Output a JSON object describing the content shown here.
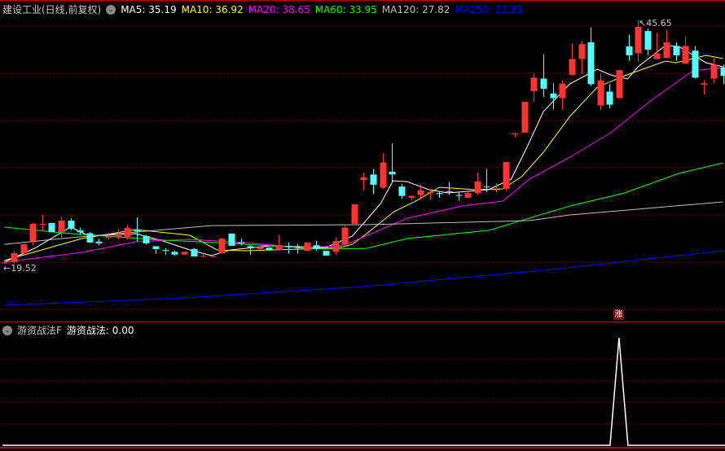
{
  "header": {
    "title": "建设工业(日线,前复权)",
    "ma_labels": [
      {
        "text": "MA5: 35.19",
        "color": "#ffffff"
      },
      {
        "text": "MA10: 36.92",
        "color": "#ffff00"
      },
      {
        "text": "MA20: 38.65",
        "color": "#ff00ff"
      },
      {
        "text": "MA60: 33.95",
        "color": "#00ff00"
      },
      {
        "text": "MA120: 27.82",
        "color": "#c0c0c0"
      },
      {
        "text": "MA250: 22.81",
        "color": "#0000ff"
      }
    ]
  },
  "indicator": {
    "name": "游资战法F",
    "value_label": "游资战法: 0.00",
    "signal_badge": "涨"
  },
  "colors": {
    "up": "#ff3333",
    "down": "#54ffff",
    "grid": "#8b0000",
    "border": "#b00000",
    "indicator_line": "#ffffff"
  },
  "chart_data": {
    "type": "candlestick",
    "title": "建设工业(日线,前复权)",
    "price_range": [
      19.52,
      45.65
    ],
    "max_label": "45.65",
    "min_label": "19.52",
    "candles_ohlc": [
      [
        19.6,
        19.8,
        19.52,
        19.65
      ],
      [
        19.69,
        20.9,
        19.55,
        20.65
      ],
      [
        20.65,
        21.7,
        20.6,
        21.61
      ],
      [
        21.96,
        23.9,
        21.5,
        23.8
      ],
      [
        23.7,
        24.76,
        23.0,
        23.8
      ],
      [
        23.9,
        23.9,
        22.9,
        22.9
      ],
      [
        22.9,
        24.6,
        22.1,
        24.15
      ],
      [
        24.15,
        24.4,
        23.1,
        23.27
      ],
      [
        23.1,
        23.4,
        22.6,
        22.9
      ],
      [
        22.8,
        22.9,
        21.8,
        21.8
      ],
      [
        21.9,
        22.2,
        21.5,
        21.7
      ],
      [
        22.3,
        22.7,
        22.1,
        22.5
      ],
      [
        22.4,
        23.2,
        22.1,
        22.7
      ],
      [
        22.4,
        23.7,
        22.1,
        23.36
      ],
      [
        23.1,
        24.5,
        21.9,
        23.0
      ],
      [
        22.5,
        22.6,
        21.6,
        21.7
      ],
      [
        21.4,
        21.4,
        20.6,
        21.1
      ],
      [
        21.0,
        21.2,
        20.5,
        20.9
      ],
      [
        20.8,
        20.9,
        20.4,
        20.5
      ],
      [
        20.5,
        20.8,
        20.5,
        20.8
      ],
      [
        21.1,
        21.2,
        20.3,
        20.3
      ],
      [
        20.3,
        20.6,
        20.2,
        20.35
      ],
      [
        20.3,
        20.5,
        20.2,
        20.35
      ],
      [
        20.65,
        22.3,
        20.6,
        22.2
      ],
      [
        22.75,
        22.75,
        21.45,
        21.45
      ],
      [
        21.8,
        22.2,
        21.5,
        21.7
      ],
      [
        21.4,
        21.5,
        20.5,
        21.25
      ],
      [
        21.1,
        21.4,
        21.0,
        21.3
      ],
      [
        21.25,
        21.3,
        20.9,
        21.0
      ],
      [
        21.0,
        22.6,
        20.9,
        21.5
      ],
      [
        21.4,
        21.8,
        20.6,
        21.35
      ],
      [
        21.3,
        21.6,
        20.6,
        21.25
      ],
      [
        20.9,
        21.8,
        20.9,
        21.8
      ],
      [
        21.5,
        22.0,
        20.9,
        21.1
      ],
      [
        20.9,
        20.9,
        20.4,
        20.4
      ],
      [
        20.8,
        22.3,
        20.5,
        21.96
      ],
      [
        21.6,
        23.6,
        21.4,
        23.4
      ],
      [
        23.8,
        25.9,
        23.8,
        25.9
      ],
      [
        28.5,
        29.3,
        27.4,
        28.8
      ],
      [
        29.1,
        29.7,
        27.0,
        28.0
      ],
      [
        27.7,
        31.4,
        27.5,
        30.4
      ],
      [
        29.4,
        32.45,
        28.3,
        29.1
      ],
      [
        27.8,
        28.1,
        26.5,
        26.8
      ],
      [
        26.6,
        26.9,
        26.3,
        26.8
      ],
      [
        26.9,
        28.0,
        26.4,
        27.4
      ],
      [
        27.1,
        27.5,
        26.4,
        27.2
      ],
      [
        27.1,
        27.3,
        26.6,
        27.0
      ],
      [
        27.3,
        28.3,
        26.9,
        27.2
      ],
      [
        26.9,
        27.2,
        26.3,
        26.8
      ],
      [
        26.6,
        27.3,
        26.6,
        27.1
      ],
      [
        27.1,
        29.3,
        26.9,
        28.35
      ],
      [
        27.8,
        29.7,
        27.2,
        27.75
      ],
      [
        27.4,
        28.2,
        27.2,
        27.5
      ],
      [
        27.55,
        30.44,
        27.3,
        30.44
      ],
      [
        33.4,
        33.5,
        33.1,
        33.5
      ],
      [
        33.6,
        36.9,
        33.6,
        36.9
      ],
      [
        38.05,
        40.0,
        36.9,
        39.5
      ],
      [
        39.4,
        42.0,
        37.4,
        38.3
      ],
      [
        37.8,
        38.9,
        36.1,
        37.3
      ],
      [
        37.3,
        39.2,
        36.1,
        38.85
      ],
      [
        39.8,
        43.1,
        39.7,
        41.5
      ],
      [
        41.5,
        43.4,
        39.9,
        43.1
      ],
      [
        43.3,
        44.9,
        38.6,
        38.8
      ],
      [
        36.5,
        40.0,
        36.0,
        39.2
      ],
      [
        38.0,
        38.8,
        36.2,
        36.6
      ],
      [
        37.3,
        40.3,
        37.3,
        40.3
      ],
      [
        42.85,
        44.1,
        41.3,
        41.9
      ],
      [
        42.1,
        45.65,
        41.2,
        44.95
      ],
      [
        44.5,
        44.8,
        41.9,
        42.5
      ],
      [
        41.5,
        44.3,
        41.5,
        42.1
      ],
      [
        41.6,
        44.6,
        41.6,
        43.3
      ],
      [
        42.9,
        43.3,
        41.3,
        41.9
      ],
      [
        41.0,
        43.9,
        41.0,
        42.9
      ],
      [
        42.4,
        42.9,
        39.4,
        39.5
      ],
      [
        38.75,
        39.2,
        37.7,
        38.9
      ],
      [
        39.4,
        41.6,
        38.9,
        40.9
      ],
      [
        40.6,
        40.9,
        38.8,
        39.7
      ]
    ],
    "max_index": 67,
    "min_index": 0,
    "ma_series": [
      {
        "name": "MA5",
        "color": "#ffffff",
        "points": [
          [
            0,
            19.69
          ],
          [
            3.2,
            21.18
          ],
          [
            7,
            23.45
          ],
          [
            9,
            22.49
          ],
          [
            13.9,
            22.75
          ],
          [
            16.8,
            21.96
          ],
          [
            19.6,
            21.0
          ],
          [
            21.9,
            20.39
          ],
          [
            23.9,
            21.0
          ],
          [
            28.2,
            21.44
          ],
          [
            34,
            21.26
          ],
          [
            36.8,
            22.49
          ],
          [
            38.3,
            24.24
          ],
          [
            39.8,
            25.99
          ],
          [
            41.1,
            28.43
          ],
          [
            42.6,
            28.34
          ],
          [
            44.9,
            27.47
          ],
          [
            46.9,
            27.12
          ],
          [
            51.2,
            27.47
          ],
          [
            53.6,
            28.61
          ],
          [
            55.3,
            32.1
          ],
          [
            57,
            35.86
          ],
          [
            59.8,
            38.83
          ],
          [
            62.7,
            40.41
          ],
          [
            64.1,
            39.79
          ],
          [
            65.9,
            39.36
          ],
          [
            67,
            40.67
          ],
          [
            69.9,
            42.94
          ],
          [
            71.3,
            42.85
          ],
          [
            74.2,
            41.1
          ],
          [
            76,
            40.67
          ]
        ]
      },
      {
        "name": "MA10",
        "color": "#ffff00",
        "points": [
          [
            0,
            19.87
          ],
          [
            8.2,
            22.23
          ],
          [
            13.9,
            23.19
          ],
          [
            19.6,
            22.58
          ],
          [
            22.5,
            21.0
          ],
          [
            25.4,
            20.92
          ],
          [
            31.2,
            21.09
          ],
          [
            35.5,
            21.26
          ],
          [
            36.8,
            21.61
          ],
          [
            38.3,
            22.75
          ],
          [
            41.2,
            25.11
          ],
          [
            43.5,
            26.25
          ],
          [
            46,
            27.73
          ],
          [
            49.8,
            27.47
          ],
          [
            52.7,
            27.56
          ],
          [
            54.7,
            28.87
          ],
          [
            57,
            31.49
          ],
          [
            59.8,
            35.34
          ],
          [
            62.7,
            38.48
          ],
          [
            65.6,
            39.71
          ],
          [
            69.9,
            41.28
          ],
          [
            71,
            41.1
          ],
          [
            74.2,
            41.89
          ],
          [
            76,
            41.54
          ]
        ]
      },
      {
        "name": "MA20",
        "color": "#ff00ff",
        "points": [
          [
            0,
            19.69
          ],
          [
            8.2,
            20.74
          ],
          [
            13.9,
            21.88
          ],
          [
            19.6,
            22.14
          ],
          [
            25.4,
            21.79
          ],
          [
            31.2,
            21.26
          ],
          [
            35.5,
            21.44
          ],
          [
            36.8,
            21.88
          ],
          [
            42.6,
            24.41
          ],
          [
            48.4,
            25.72
          ],
          [
            52.7,
            26.25
          ],
          [
            55.5,
            28.61
          ],
          [
            59.8,
            30.97
          ],
          [
            64.1,
            33.59
          ],
          [
            68.4,
            37.08
          ],
          [
            72.8,
            40.23
          ],
          [
            76,
            40.58
          ]
        ]
      },
      {
        "name": "MA60",
        "color": "#00ff00",
        "points": [
          [
            0,
            23.45
          ],
          [
            7,
            22.75
          ],
          [
            16.8,
            22.05
          ],
          [
            22.5,
            21.79
          ],
          [
            31.2,
            21.26
          ],
          [
            34,
            21.09
          ],
          [
            38.3,
            21.18
          ],
          [
            42.6,
            22.23
          ],
          [
            51.2,
            23.1
          ],
          [
            55.5,
            24.41
          ],
          [
            59.8,
            25.72
          ],
          [
            65.6,
            27.12
          ],
          [
            71.3,
            29.22
          ],
          [
            76,
            30.35
          ]
        ]
      },
      {
        "name": "MA120",
        "color": "#c0c0c0",
        "points": [
          [
            0,
            21.61
          ],
          [
            7,
            22.31
          ],
          [
            21.9,
            23.62
          ],
          [
            38.3,
            23.71
          ],
          [
            55.5,
            24.15
          ],
          [
            59.8,
            24.76
          ],
          [
            76,
            26.16
          ]
        ]
      },
      {
        "name": "MA250",
        "color": "#0000ff",
        "points": [
          [
            0,
            15.06
          ],
          [
            19,
            15.85
          ],
          [
            38,
            17.07
          ],
          [
            57,
            18.82
          ],
          [
            76,
            20.92
          ]
        ]
      }
    ],
    "indicator_series": {
      "name": "游资战法",
      "range": [
        0,
        1
      ],
      "signal_index": 65,
      "signal_value": 1
    }
  }
}
